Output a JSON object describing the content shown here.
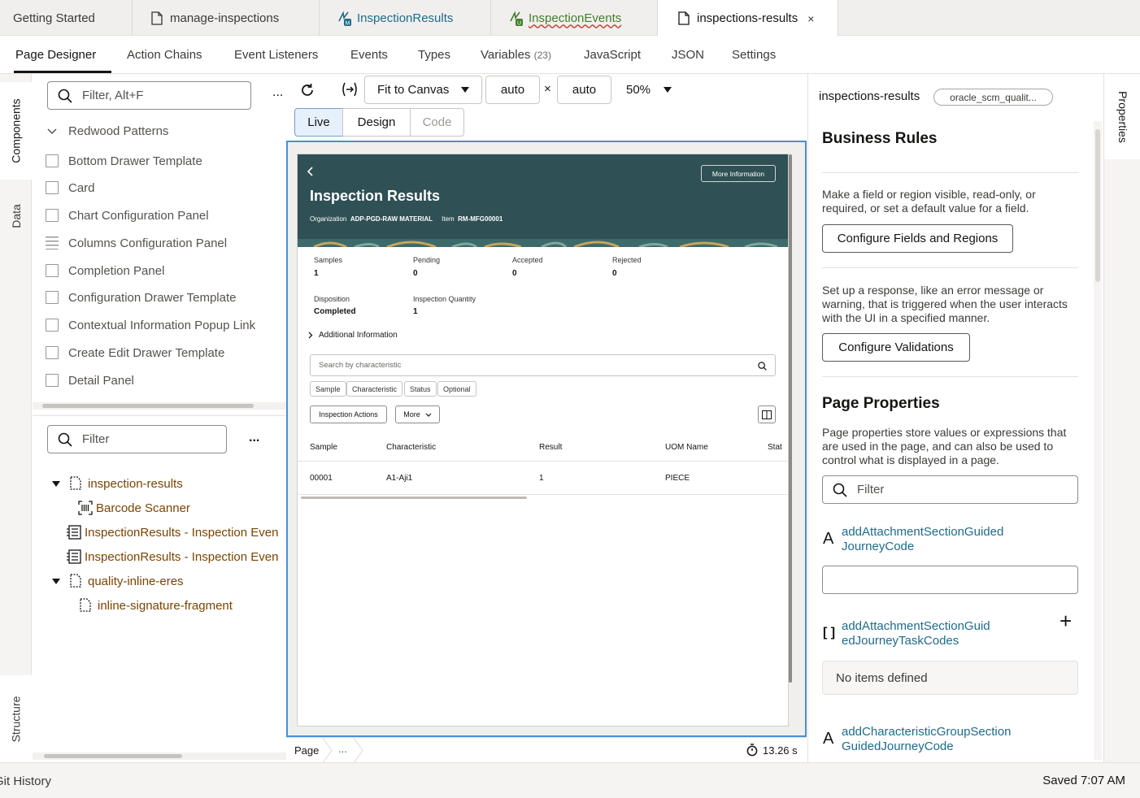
{
  "file_tabs": [
    {
      "label": "Getting Started"
    },
    {
      "label": "manage-inspections",
      "icon": "page-icon"
    },
    {
      "label": "InspectionResults",
      "icon": "action-chain-icon",
      "badge": "M"
    },
    {
      "label": "InspectionEvents",
      "icon": "action-chain-icon",
      "badge": "U"
    },
    {
      "label": "inspections-results",
      "icon": "page-icon",
      "close": "×"
    }
  ],
  "designer_tabs": [
    {
      "label": "Page Designer"
    },
    {
      "label": "Action Chains"
    },
    {
      "label": "Event Listeners"
    },
    {
      "label": "Events"
    },
    {
      "label": "Types"
    },
    {
      "label": "Variables",
      "count": "(23)"
    },
    {
      "label": "JavaScript"
    },
    {
      "label": "JSON"
    },
    {
      "label": "Settings"
    }
  ],
  "left_rail": {
    "components": "Components",
    "data": "Data",
    "structure": "Structure"
  },
  "components": {
    "filter_placeholder": "Filter, Alt+F",
    "more": "...",
    "group": "Redwood Patterns",
    "items": [
      "Bottom Drawer Template",
      "Card",
      "Chart Configuration Panel",
      "Columns Configuration Panel",
      "Completion Panel",
      "Configuration Drawer Template",
      "Contextual Information Popup Link",
      "Create Edit Drawer Template",
      "Detail Panel"
    ]
  },
  "structure": {
    "filter_placeholder": "Filter",
    "more": "...",
    "items": [
      "inspection-results",
      "Barcode Scanner",
      "InspectionResults - Inspection Even",
      "InspectionResults - Inspection Even",
      "quality-inline-eres",
      "inline-signature-fragment"
    ]
  },
  "toolbar": {
    "fit": "Fit to Canvas",
    "width": "auto",
    "times": "×",
    "height": "auto",
    "zoom": "50%",
    "live": "Live",
    "design": "Design",
    "code": "Code"
  },
  "preview": {
    "more_info": "More Information",
    "title": "Inspection Results",
    "org_label": "Organization",
    "org_value": "ADP-PGD-RAW MATERIAL",
    "item_label": "Item",
    "item_value": "RM-MFG00001",
    "stats": [
      {
        "label": "Samples",
        "value": "1"
      },
      {
        "label": "Pending",
        "value": "0"
      },
      {
        "label": "Accepted",
        "value": "0"
      },
      {
        "label": "Rejected",
        "value": "0"
      },
      {
        "label": "Disposition",
        "value": "Completed"
      },
      {
        "label": "Inspection Quantity",
        "value": "1"
      }
    ],
    "additional": "Additional Information",
    "search_placeholder": "Search by characteristic",
    "chips": [
      "Sample",
      "Characteristic",
      "Status",
      "Optional"
    ],
    "actions": "Inspection Actions",
    "more": "More",
    "columns": [
      "Sample",
      "Characteristic",
      "Result",
      "UOM Name",
      "Stat"
    ],
    "rows": [
      [
        "00001",
        "A1-Aji1",
        "1",
        "PIECE"
      ]
    ]
  },
  "breadcrumb": {
    "page": "Page",
    "ellipsis": "...",
    "timer": "13.26 s"
  },
  "properties": {
    "page_name": "inspections-results",
    "app_badge": "oracle_scm_qualit...",
    "business_rules": "Business Rules",
    "br_desc": "Make a field or region visible, read-only, or required, or set a default value for a field.",
    "configure_fields": "Configure Fields and Regions",
    "val_desc": "Set up a response, like an error message or warning, that is triggered when the user interacts with the UI in a specified manner.",
    "configure_validations": "Configure Validations",
    "page_properties": "Page Properties",
    "pp_desc": "Page properties store values or expressions that are used in the page, and can also be used to control what is displayed in a page.",
    "filter_placeholder": "Filter",
    "prop1_line1": "addAttachmentSectionGuided",
    "prop1_line2": "JourneyCode",
    "prop1_icon": "A",
    "prop2_line1": "addAttachmentSectionGuid",
    "prop2_line2": "edJourneyTaskCodes",
    "prop2_icon": "[ ]",
    "prop2_add": "+",
    "no_items": "No items defined",
    "prop3_line1": "addCharacteristicGroupSection",
    "prop3_line2": "GuidedJourneyCode",
    "prop3_icon": "A"
  },
  "right_rail": {
    "properties": "Properties"
  },
  "status": {
    "git": "Git History",
    "saved": "Saved 7:07 AM"
  }
}
